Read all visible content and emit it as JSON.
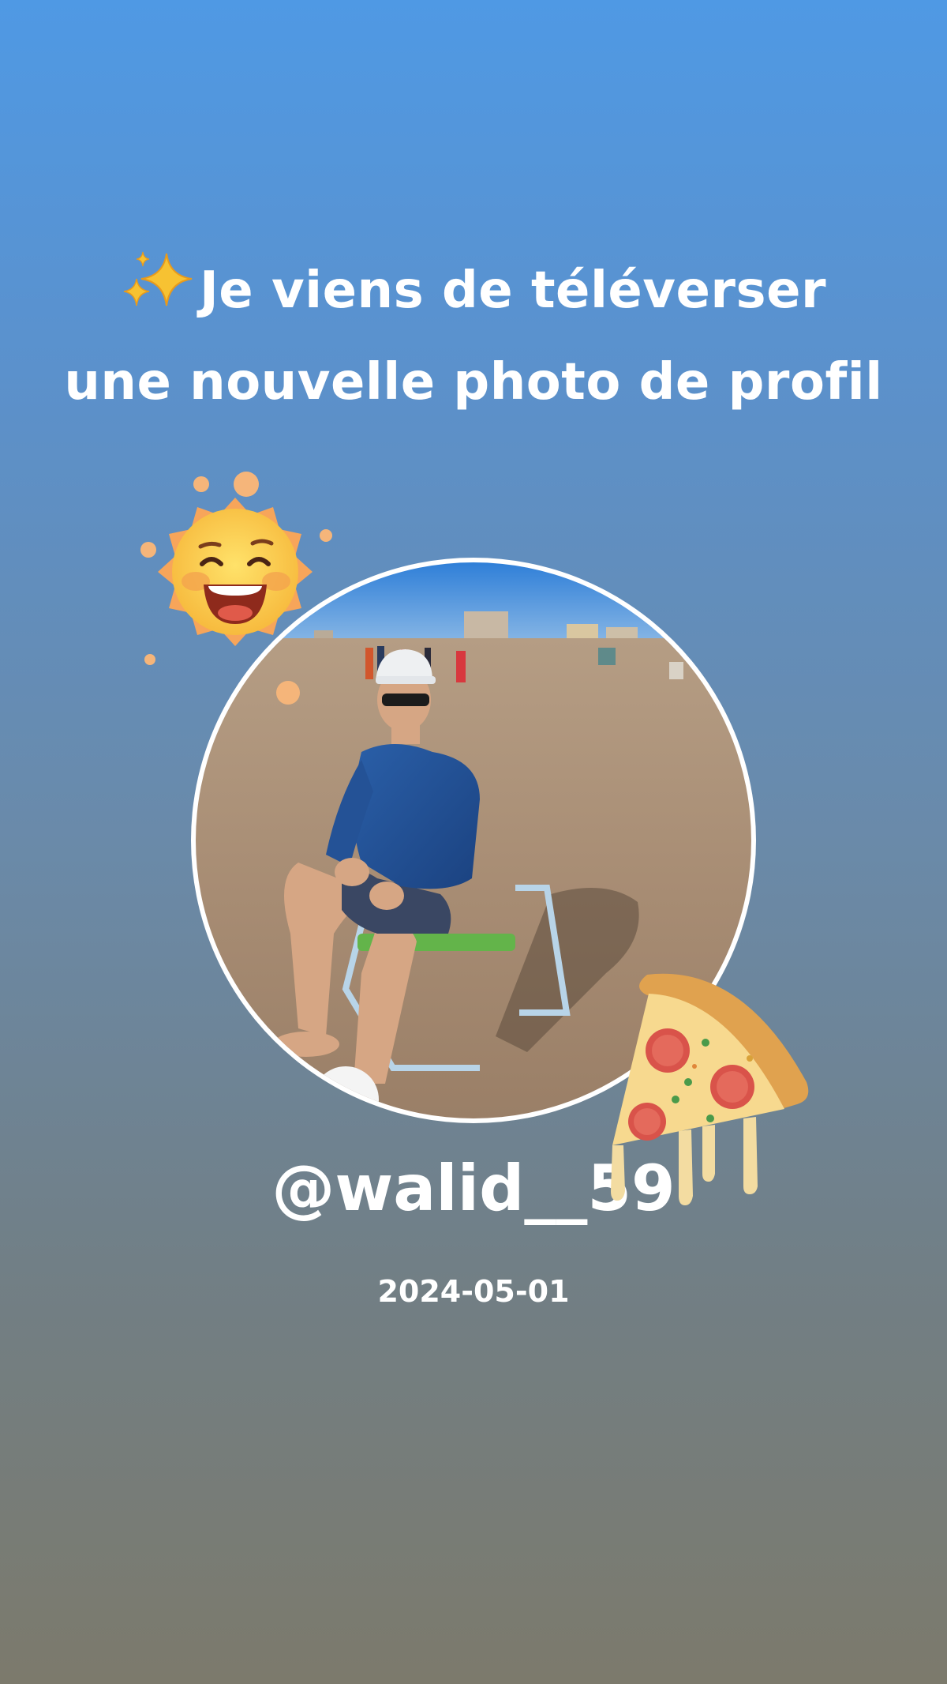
{
  "story": {
    "headline": "Je viens de téléverser une nouvelle photo de profil",
    "username": "@walid__59",
    "date": "2024-05-01"
  },
  "icons": {
    "headline_prefix": "sparkles-icon",
    "sticker_top_left": "laughing-sun-icon",
    "sticker_bottom_right": "pizza-slice-icon"
  },
  "colors": {
    "gradient_top": "#4f99e4",
    "gradient_bottom": "#7c7a6c",
    "ring": "#ffffff",
    "text": "#ffffff"
  }
}
